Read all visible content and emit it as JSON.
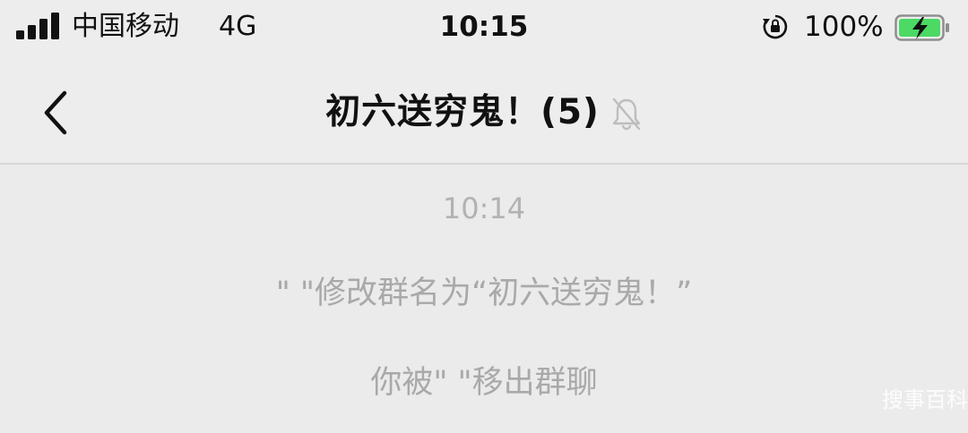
{
  "status_bar": {
    "carrier": "中国移动",
    "network": "4G",
    "time": "10:15",
    "battery_percent": "100%",
    "icons": [
      "signal-icon",
      "orientation-lock-icon",
      "battery-charging-icon"
    ]
  },
  "header": {
    "back_icon": "chevron-left-icon",
    "title": "初六送穷鬼！(5)",
    "mute_icon": "bell-muted-icon"
  },
  "chat": {
    "timestamp": "10:14",
    "system_messages": [
      "\" \"修改群名为“初六送穷鬼！”",
      "你被\" \"移出群聊"
    ]
  },
  "watermark": {
    "text": "搜事百科"
  },
  "colors": {
    "background": "#ebebeb",
    "system_text": "#a9a9a9",
    "battery_green": "#4cd964"
  }
}
